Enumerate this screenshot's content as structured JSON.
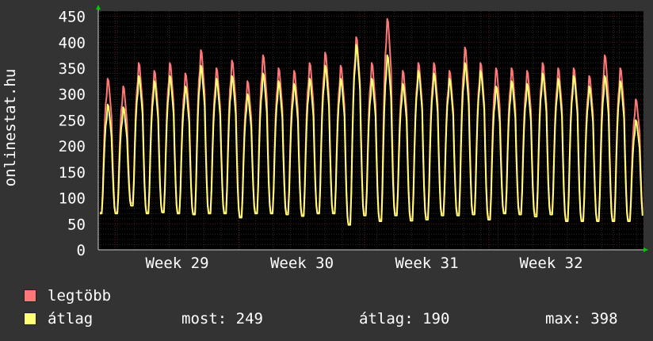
{
  "chart_data": {
    "type": "line",
    "ylabel": "onlinestat.hu",
    "ylim": [
      0,
      460
    ],
    "yticks": [
      "0",
      "50",
      "100",
      "150",
      "200",
      "250",
      "300",
      "350",
      "400",
      "450"
    ],
    "xlabels": [
      "Week 29",
      "Week 30",
      "Week 31",
      "Week 32"
    ],
    "days": 31,
    "series": [
      {
        "name": "legtöbb",
        "color": "#ff7777",
        "daily_max": [
          330,
          315,
          360,
          345,
          360,
          340,
          385,
          350,
          365,
          325,
          375,
          350,
          345,
          360,
          380,
          355,
          410,
          360,
          445,
          345,
          360,
          360,
          345,
          390,
          360,
          350,
          350,
          345,
          360,
          350,
          350,
          335,
          375,
          350,
          290
        ],
        "daily_min": [
          72,
          72,
          90,
          72,
          75,
          72,
          70,
          72,
          72,
          65,
          72,
          72,
          72,
          68,
          72,
          72,
          50,
          70,
          58,
          70,
          60,
          62,
          70,
          70,
          72,
          62,
          72,
          72,
          68,
          72,
          58
        ]
      },
      {
        "name": "átlag",
        "color": "#ffff77",
        "daily_max": [
          280,
          275,
          335,
          325,
          335,
          315,
          355,
          330,
          335,
          300,
          340,
          325,
          320,
          330,
          355,
          330,
          395,
          330,
          375,
          320,
          345,
          340,
          330,
          360,
          345,
          315,
          325,
          320,
          340,
          330,
          335,
          315,
          335,
          325,
          250
        ],
        "daily_min": [
          70,
          70,
          85,
          70,
          72,
          70,
          68,
          70,
          70,
          62,
          70,
          70,
          68,
          65,
          70,
          70,
          48,
          66,
          55,
          66,
          56,
          58,
          66,
          66,
          68,
          58,
          70,
          68,
          64,
          68,
          55
        ]
      }
    ]
  },
  "legend": [
    {
      "label": "legtöbb",
      "color": "#ff7777"
    },
    {
      "label": "átlag",
      "color": "#ffff77"
    }
  ],
  "stats": {
    "most": "most: 249",
    "atlag": "átlag: 190",
    "max": "max: 398"
  }
}
